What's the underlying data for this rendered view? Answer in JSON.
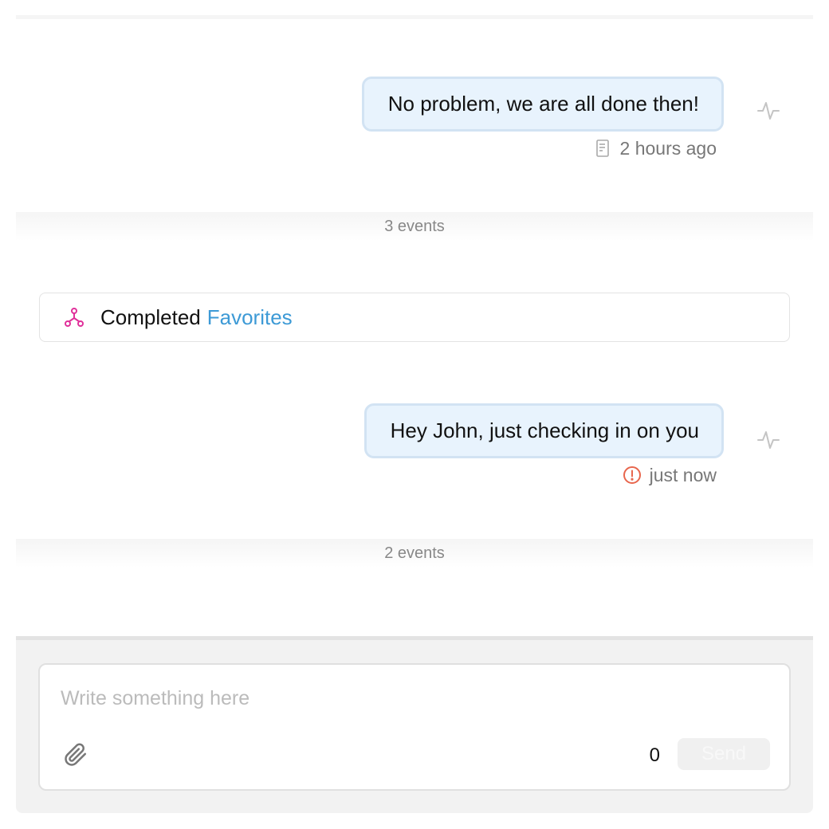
{
  "messages": [
    {
      "text": "No problem, we are all done then!",
      "status_icon": "document-icon",
      "timestamp": "2 hours ago"
    },
    {
      "text": "Hey John, just checking in on you",
      "status_icon": "error-icon",
      "timestamp": "just now"
    }
  ],
  "event_groups": [
    {
      "label": "3 events"
    },
    {
      "label": "2 events"
    }
  ],
  "event_card": {
    "icon": "workflow-icon",
    "action": "Completed",
    "link": "Favorites"
  },
  "composer": {
    "placeholder": "Write something here",
    "value": "",
    "char_count": "0",
    "send_label": "Send"
  },
  "colors": {
    "bubble_bg": "#e8f3fd",
    "bubble_border": "#d2e3f3",
    "link": "#3d9ad6",
    "error": "#e8664d",
    "workflow": "#e0309a"
  }
}
